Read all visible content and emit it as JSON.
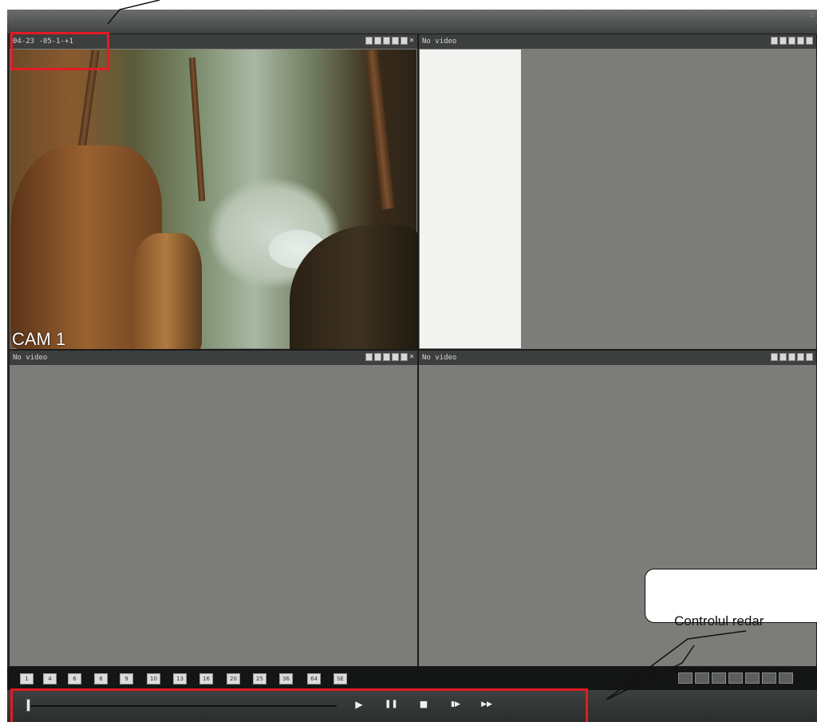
{
  "window": {
    "corner_marks": "::"
  },
  "panes": [
    {
      "id": 1,
      "header": "04-23 -05-1-+1",
      "cam_label": "CAM 1"
    },
    {
      "id": 2,
      "header": "No video"
    },
    {
      "id": 3,
      "header": "No video"
    },
    {
      "id": 4,
      "header": "No video"
    }
  ],
  "pane_tool_icons": [
    "record-icon",
    "snapshot-icon",
    "zoom-icon",
    "display-icon",
    "audio-icon",
    "close-icon"
  ],
  "layout_buttons": [
    "1",
    "4",
    "6",
    "8",
    "9",
    "10",
    "13",
    "16",
    "20",
    "25",
    "36",
    "64",
    "SE"
  ],
  "playback": {
    "progress": 0.0,
    "buttons": [
      "play",
      "pause",
      "stop",
      "step",
      "fast-forward"
    ],
    "symbols": {
      "play": "▶",
      "pause": "❚❚",
      "stop": "■",
      "step": "▮▶",
      "fast-forward": "▶▶"
    }
  },
  "annotation": {
    "callout": "Controlul redar"
  },
  "colors": {
    "annotation_red": "#e31b23",
    "pane_bg": "#7c7d79"
  }
}
